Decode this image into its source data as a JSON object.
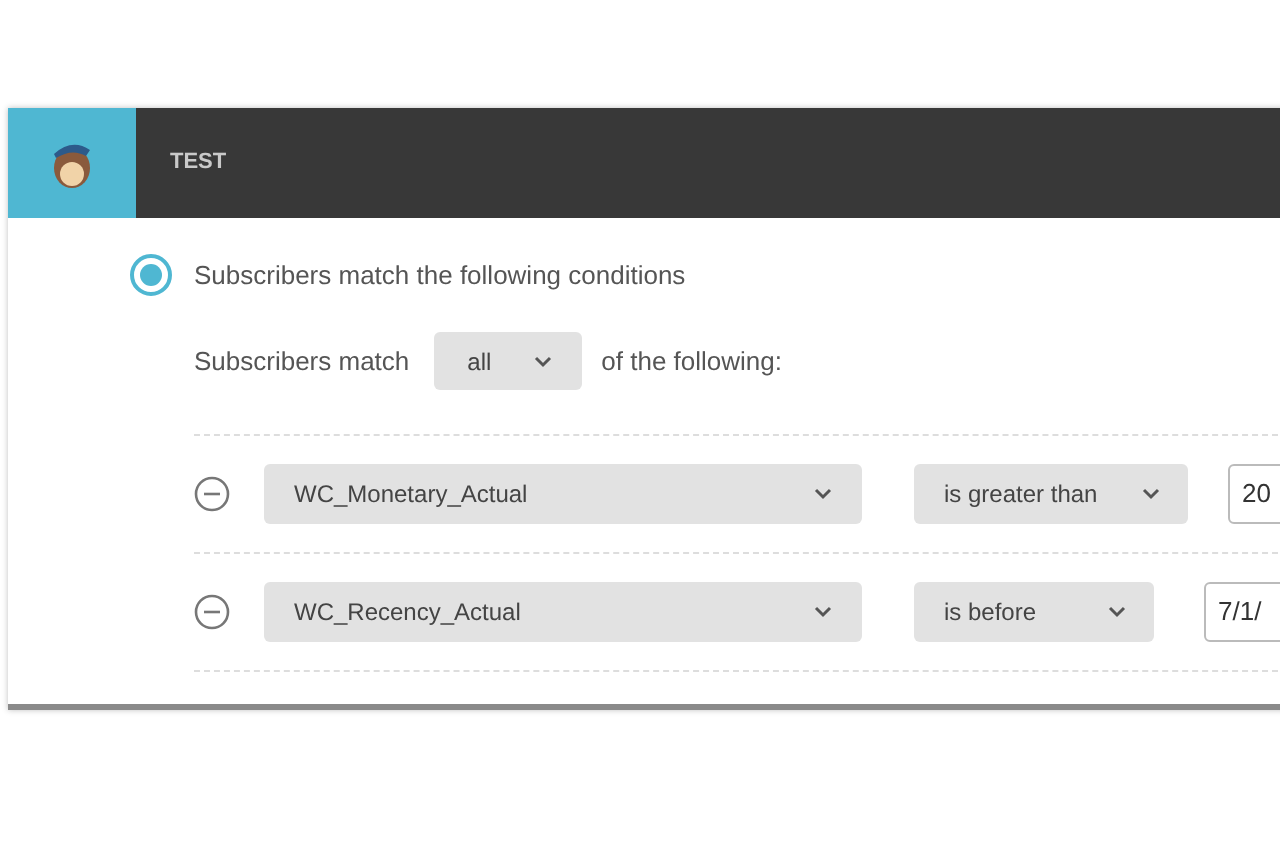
{
  "header": {
    "title": "TEST"
  },
  "option": {
    "label": "Subscribers match the following conditions",
    "selected": true
  },
  "match": {
    "prefix": "Subscribers match",
    "value": "all",
    "suffix": "of the following:"
  },
  "conditions": [
    {
      "field": "WC_Monetary_Actual",
      "operator": "is greater than",
      "value": "20"
    },
    {
      "field": "WC_Recency_Actual",
      "operator": "is before",
      "value": "7/1/"
    }
  ]
}
